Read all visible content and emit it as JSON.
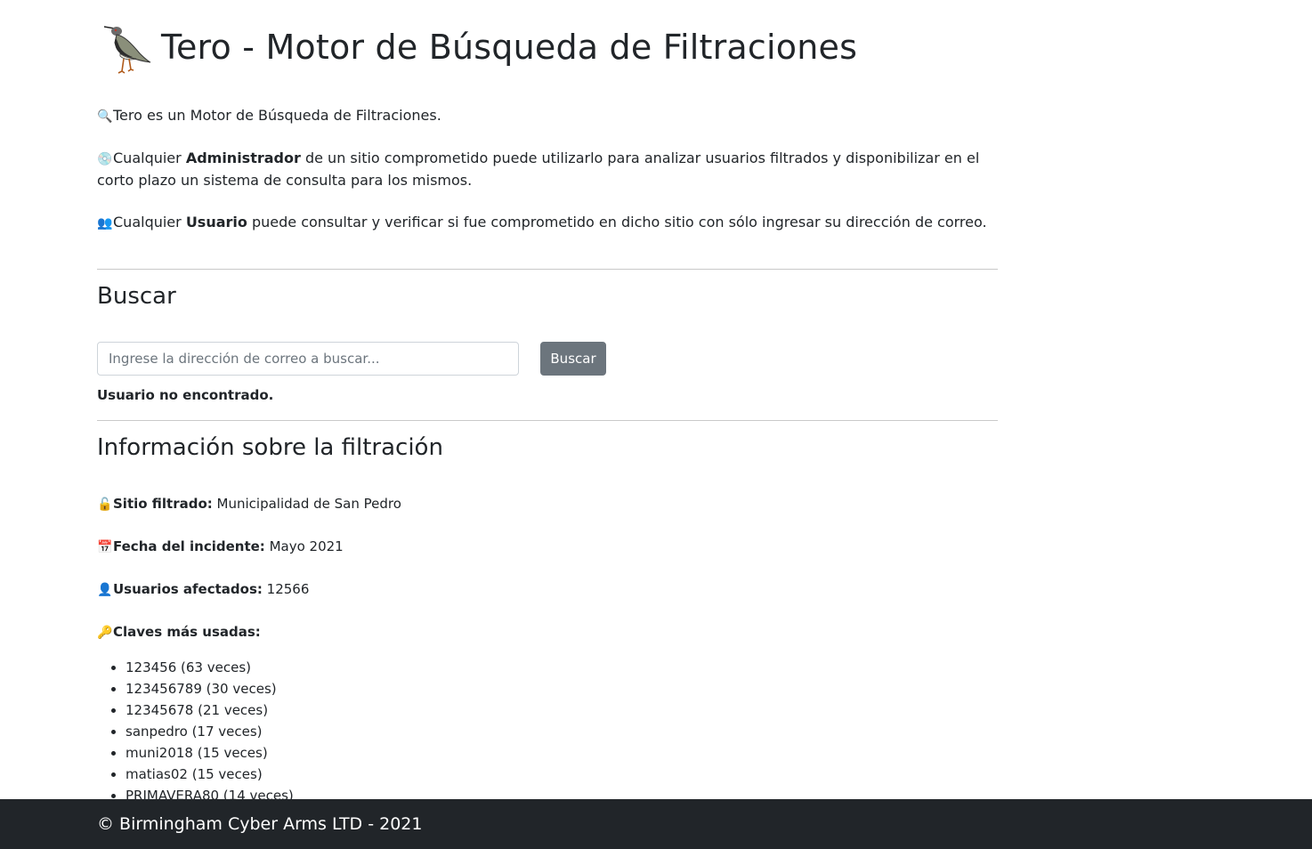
{
  "header": {
    "title": "Tero - Motor de Búsqueda de Filtraciones"
  },
  "intro": {
    "line1": {
      "icon": "magnifier-icon",
      "text": "Tero es un Motor de Búsqueda de Filtraciones."
    },
    "line2": {
      "icon": "disc-icon",
      "prefix": "Cualquier ",
      "bold": "Administrador",
      "suffix": " de un sitio comprometido puede utilizarlo para analizar usuarios filtrados y disponibilizar en el corto plazo un sistema de consulta para los mismos."
    },
    "line3": {
      "icon": "users-icon",
      "prefix": "Cualquier ",
      "bold": "Usuario",
      "suffix": " puede consultar y verificar si fue comprometido en dicho sitio con sólo ingresar su dirección de correo."
    }
  },
  "search": {
    "heading": "Buscar",
    "placeholder": "Ingrese la dirección de correo a buscar...",
    "value": "",
    "button_label": "Buscar",
    "result_text": "Usuario no encontrado."
  },
  "info": {
    "heading": "Información sobre la filtración",
    "site_label": "Sitio filtrado:",
    "site_value": " Municipalidad de San Pedro",
    "date_label": "Fecha del incidente:",
    "date_value": " Mayo 2021",
    "users_label": "Usuarios afectados:",
    "users_value": " 12566",
    "passwords_label": "Claves más usadas:",
    "passwords": [
      "123456 (63 veces)",
      "123456789 (30 veces)",
      "12345678 (21 veces)",
      "sanpedro (17 veces)",
      "muni2018 (15 veces)",
      "matias02 (15 veces)",
      "PRIMAVERA80 (14 veces)"
    ]
  },
  "footer": {
    "text": "© Birmingham Cyber Arms LTD - 2021"
  },
  "colors": {
    "footer_bg": "#212529",
    "button_bg": "#6c757d",
    "text": "#212529"
  }
}
